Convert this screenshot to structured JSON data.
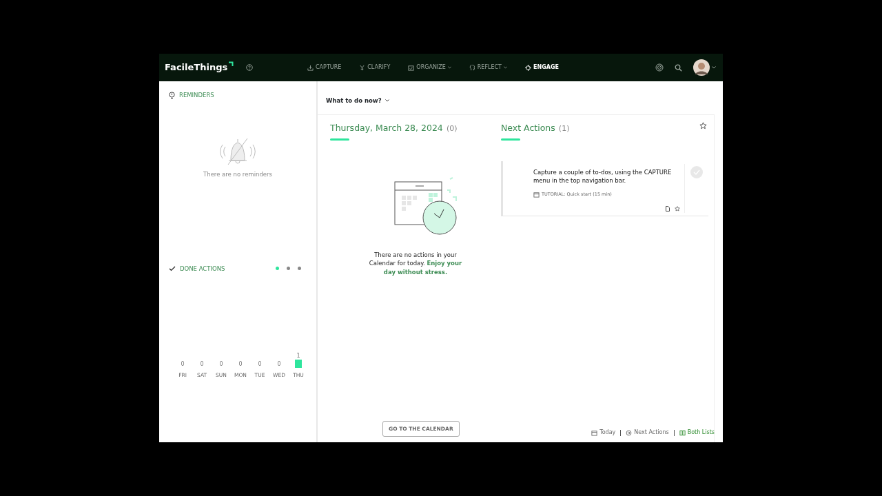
{
  "app": {
    "logo": "FacileThings"
  },
  "nav": [
    {
      "label": "CAPTURE",
      "kind": "capture",
      "dropdown": false,
      "selected": false
    },
    {
      "label": "CLARIFY",
      "kind": "clarify",
      "dropdown": false,
      "selected": false
    },
    {
      "label": "ORGANIZE",
      "kind": "organize",
      "dropdown": true,
      "selected": false
    },
    {
      "label": "REFLECT",
      "kind": "reflect",
      "dropdown": true,
      "selected": false
    },
    {
      "label": "ENGAGE",
      "kind": "engage",
      "dropdown": false,
      "selected": true
    }
  ],
  "reminders": {
    "title": "REMINDERS",
    "empty_text": "There are no reminders"
  },
  "done_actions": {
    "title": "DONE ACTIONS",
    "pages": [
      {
        "selected": true
      },
      {
        "selected": false
      },
      {
        "selected": false
      }
    ],
    "chart_data": {
      "type": "bar",
      "categories": [
        "FRI",
        "SAT",
        "SUN",
        "MON",
        "TUE",
        "WED",
        "THU"
      ],
      "values": [
        0,
        0,
        0,
        0,
        0,
        0,
        1
      ],
      "data_labels": true
    }
  },
  "view_menu": {
    "label": "What to do now?"
  },
  "calendar": {
    "title": "Thursday, March 28, 2024",
    "count": "(0)",
    "empty_text": "There are no actions in your Calendar for today. **Enjoy your day without stress.**",
    "button": "GO TO THE CALENDAR"
  },
  "next_actions": {
    "title": "Next Actions",
    "count": "(1)",
    "items": [
      {
        "text": "Capture a couple of to-dos, using the CAPTURE menu in the top navigation bar.",
        "project": "TUTORIAL: Quick start (15 min)",
        "done": false
      }
    ]
  },
  "view_switch": [
    {
      "label": "Today",
      "kind": "calendar",
      "selected": false
    },
    {
      "label": "Next Actions",
      "kind": "actions",
      "selected": false
    },
    {
      "label": "Both Lists",
      "kind": "columns",
      "selected": true
    }
  ]
}
